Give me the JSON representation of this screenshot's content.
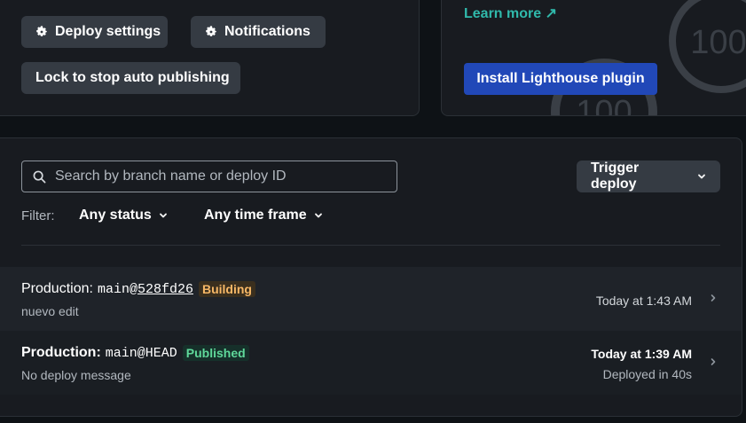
{
  "top_left": {
    "deploy_settings_label": "Deploy settings",
    "notifications_label": "Notifications",
    "lock_label": "Lock to stop auto publishing"
  },
  "top_right": {
    "learn_more_label": "Learn more ↗",
    "install_label": "Install Lighthouse plugin",
    "gauge_score": "100"
  },
  "deploys": {
    "search_placeholder": "Search by branch name or deploy ID",
    "search_value": "",
    "trigger_label": "Trigger deploy",
    "filter_label": "Filter:",
    "status_filter": "Any status",
    "time_filter": "Any time frame",
    "rows": [
      {
        "context": "Production:",
        "branch": "main@",
        "ref": "528fd26",
        "status": "Building",
        "message": "nuevo edit",
        "time": "Today at 1:43 AM",
        "sub": ""
      },
      {
        "context": "Production:",
        "branch": "main@",
        "ref": "HEAD",
        "status": "Published",
        "message": "No deploy message",
        "time": "Today at 1:39 AM",
        "sub": "Deployed in 40s"
      }
    ]
  },
  "colors": {
    "page_bg": "#0e1216",
    "card_bg": "#181b20",
    "button_bg": "#353b43",
    "accent_teal": "#30b9ab",
    "primary_blue": "#2148b8",
    "building_badge": "#f6b766",
    "published_badge": "#5fd89a"
  }
}
